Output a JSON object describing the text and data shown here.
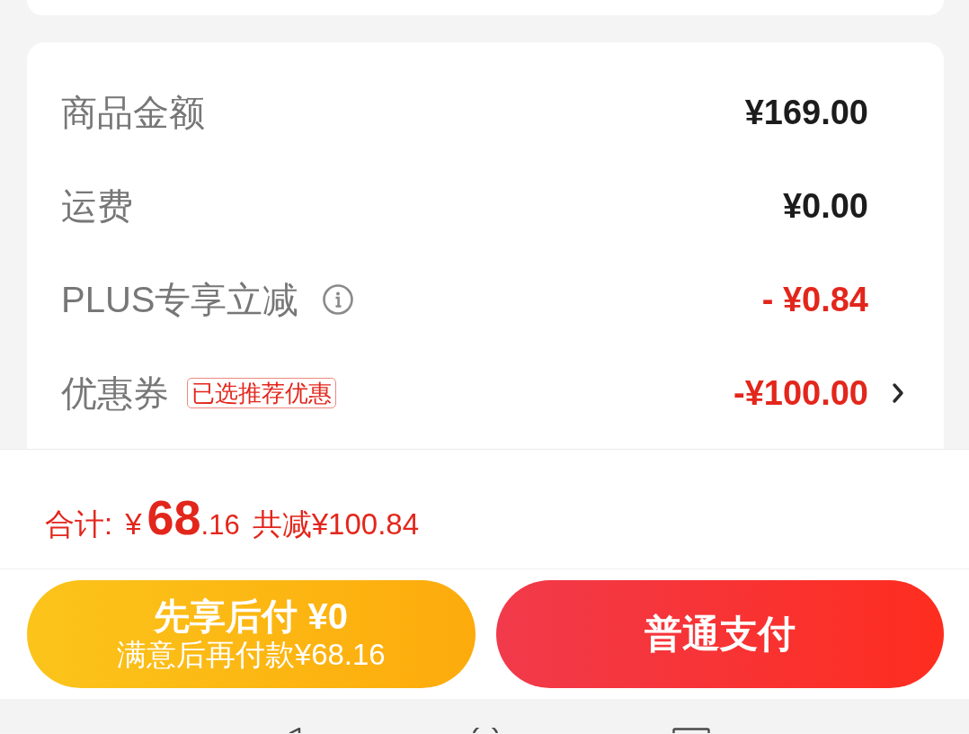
{
  "price_details": {
    "rows": [
      {
        "kind": "charge",
        "label": "商品金额",
        "value": "¥169.00"
      },
      {
        "kind": "charge",
        "label": "运费",
        "value": "¥0.00"
      },
      {
        "kind": "discount",
        "label": "PLUS专享立减",
        "info": true,
        "value": "- ¥0.84"
      },
      {
        "kind": "discount",
        "label": "优惠券",
        "tag": "已选推荐优惠",
        "value": "-¥100.00",
        "chevron": true
      }
    ]
  },
  "total": {
    "label": "合计:",
    "currency": "¥",
    "integer": "68",
    "decimal": ".16",
    "saving": "共减¥100.84"
  },
  "actions": [
    {
      "kind": "pay_later",
      "title": "先享后付 ¥0",
      "subtitle": "满意后再付款¥68.16"
    },
    {
      "kind": "pay_now",
      "title": "普通支付"
    }
  ]
}
